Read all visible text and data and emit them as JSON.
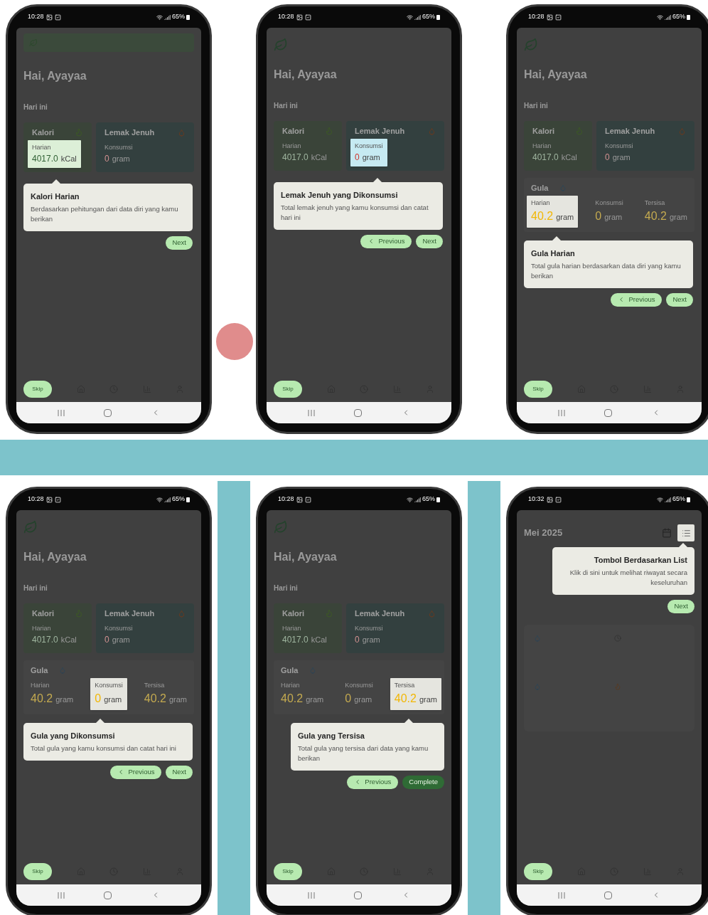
{
  "phones": [
    {
      "time": "10:28",
      "battery": "65%",
      "kind": "home",
      "search_bar": true,
      "greeting": "Hai, Ayayaa",
      "section": "Hari ini",
      "cards": [
        {
          "kind": "kalori",
          "title": "Kalori",
          "highlighted": true,
          "label": "Harian",
          "value": "4017.0",
          "unit": "kCal"
        },
        {
          "kind": "lemak",
          "title": "Lemak Jenuh",
          "highlighted": false,
          "label": "Konsumsi",
          "value": "0",
          "unit": "gram"
        }
      ],
      "tooltip": {
        "kind": "left",
        "title": "Kalori Harian",
        "body": "Berdasarkan pehitungan dari data diri yang kamu berikan"
      },
      "buttons": [
        {
          "label": "Next",
          "kind": "next"
        }
      ],
      "skip": "Skip"
    },
    {
      "time": "10:28",
      "battery": "65%",
      "kind": "home",
      "search_bar": false,
      "greeting": "Hai, Ayayaa",
      "section": "Hari ini",
      "cards": [
        {
          "kind": "kalori",
          "title": "Kalori",
          "highlighted": false,
          "label": "Harian",
          "value": "4017.0",
          "unit": "kCal"
        },
        {
          "kind": "lemak",
          "title": "Lemak Jenuh",
          "highlighted": true,
          "label": "Konsumsi",
          "value": "0",
          "unit": "gram"
        }
      ],
      "tooltip": {
        "kind": "left",
        "title": "Lemak Jenuh yang Dikonsumsi",
        "body": "Total lemak jenuh yang kamu konsumsi dan catat hari ini"
      },
      "buttons": [
        {
          "label": "Previous",
          "kind": "previous"
        },
        {
          "label": "Next",
          "kind": "next"
        }
      ],
      "skip": "Skip"
    },
    {
      "time": "10:28",
      "battery": "65%",
      "kind": "home",
      "search_bar": false,
      "greeting": "Hai, Ayayaa",
      "section": "Hari ini",
      "cards": [
        {
          "kind": "kalori",
          "title": "Kalori",
          "highlighted": false,
          "label": "Harian",
          "value": "4017.0",
          "unit": "kCal"
        },
        {
          "kind": "lemak",
          "title": "Lemak Jenuh",
          "highlighted": false,
          "label": "Konsumsi",
          "value": "0",
          "unit": "gram"
        }
      ],
      "gula": {
        "title": "Gula",
        "items": [
          {
            "highlighted": true,
            "label": "Harian",
            "value": "40.2",
            "unit": "gram"
          },
          {
            "highlighted": false,
            "label": "Konsumsi",
            "value": "0",
            "unit": "gram"
          },
          {
            "highlighted": false,
            "label": "Tersisa",
            "value": "40.2",
            "unit": "gram"
          }
        ]
      },
      "tooltip": {
        "kind": "left",
        "title": "Gula Harian",
        "body": "Total gula harian berdasarkan data diri yang kamu berikan"
      },
      "buttons": [
        {
          "label": "Previous",
          "kind": "previous"
        },
        {
          "label": "Next",
          "kind": "next"
        }
      ],
      "skip": "Skip"
    },
    {
      "time": "10:28",
      "battery": "65%",
      "kind": "home",
      "search_bar": false,
      "greeting": "Hai, Ayayaa",
      "section": "Hari ini",
      "cards": [
        {
          "kind": "kalori",
          "title": "Kalori",
          "highlighted": false,
          "label": "Harian",
          "value": "4017.0",
          "unit": "kCal"
        },
        {
          "kind": "lemak",
          "title": "Lemak Jenuh",
          "highlighted": false,
          "label": "Konsumsi",
          "value": "0",
          "unit": "gram"
        }
      ],
      "gula": {
        "title": "Gula",
        "items": [
          {
            "highlighted": false,
            "label": "Harian",
            "value": "40.2",
            "unit": "gram"
          },
          {
            "highlighted": true,
            "label": "Konsumsi",
            "value": "0",
            "unit": "gram"
          },
          {
            "highlighted": false,
            "label": "Tersisa",
            "value": "40.2",
            "unit": "gram"
          }
        ]
      },
      "tooltip": {
        "kind": "left",
        "title": "Gula yang Dikonsumsi",
        "body": "Total gula yang kamu konsumsi dan catat hari ini"
      },
      "buttons": [
        {
          "label": "Previous",
          "kind": "previous"
        },
        {
          "label": "Next",
          "kind": "next"
        }
      ],
      "skip": "Skip"
    },
    {
      "time": "10:28",
      "battery": "65%",
      "kind": "home",
      "search_bar": false,
      "greeting": "Hai, Ayayaa",
      "section": "Hari ini",
      "cards": [
        {
          "kind": "kalori",
          "title": "Kalori",
          "highlighted": false,
          "label": "Harian",
          "value": "4017.0",
          "unit": "kCal"
        },
        {
          "kind": "lemak",
          "title": "Lemak Jenuh",
          "highlighted": false,
          "label": "Konsumsi",
          "value": "0",
          "unit": "gram"
        }
      ],
      "gula": {
        "title": "Gula",
        "items": [
          {
            "highlighted": false,
            "label": "Harian",
            "value": "40.2",
            "unit": "gram"
          },
          {
            "highlighted": false,
            "label": "Konsumsi",
            "value": "0",
            "unit": "gram"
          },
          {
            "highlighted": true,
            "label": "Tersisa",
            "value": "40.2",
            "unit": "gram"
          }
        ]
      },
      "tooltip": {
        "kind": "right",
        "title": "Gula yang Tersisa",
        "body": "Total gula yang tersisa dari data yang kamu berikan"
      },
      "buttons": [
        {
          "label": "Previous",
          "kind": "previous"
        },
        {
          "label": "Complete",
          "kind": "complete"
        }
      ],
      "skip": "Skip"
    },
    {
      "time": "10:32",
      "battery": "65%",
      "kind": "history",
      "month": "Mei 2025",
      "tooltip": {
        "kind": "right_text",
        "title": "Tombol Berdasarkan List",
        "body": "Klik di sini untuk melihat riwayat secara keseluruhan"
      },
      "buttons": [
        {
          "label": "Next",
          "kind": "next"
        }
      ],
      "skip": "Skip"
    }
  ]
}
